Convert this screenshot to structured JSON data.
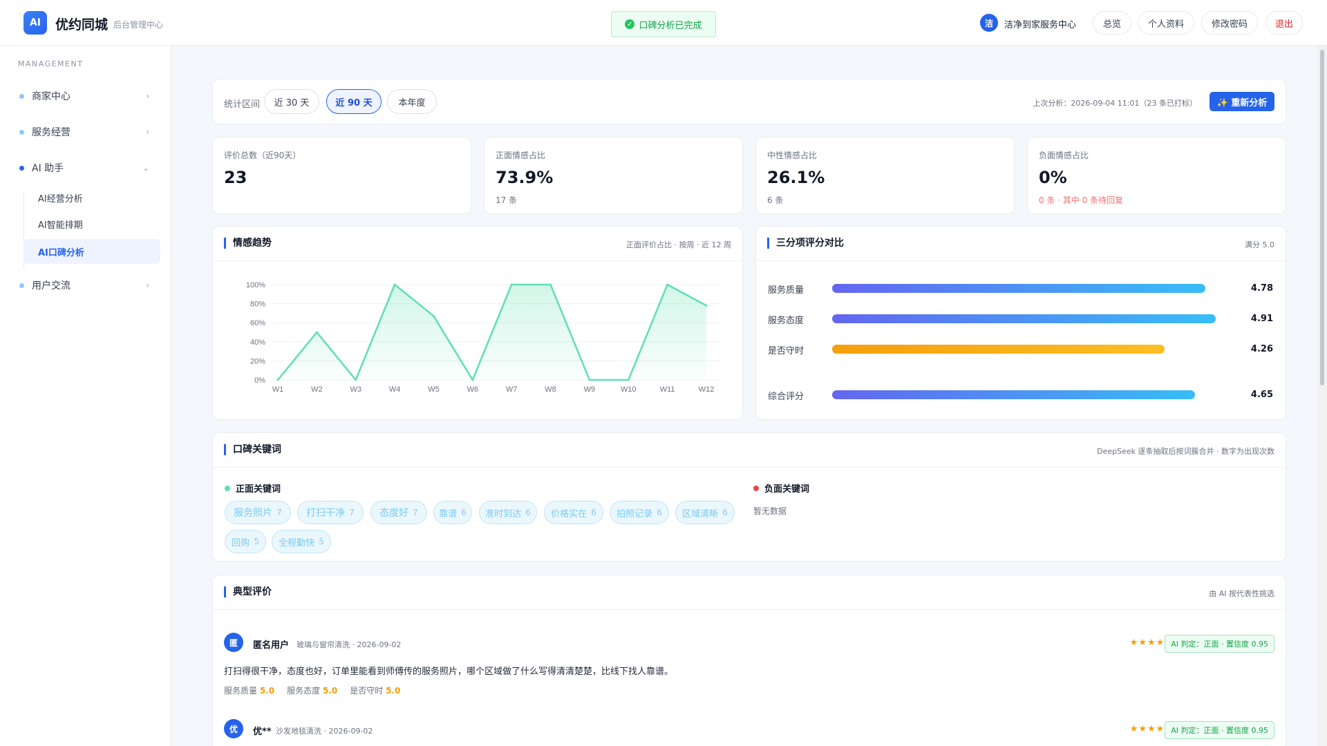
{
  "header": {
    "logo": "AI",
    "brand": "优约同城",
    "subtitle": "后台管理中心",
    "toast": "口碑分析已完成",
    "merchant_avatar": "洁",
    "merchant_name": "洁净到家服务中心",
    "buttons": {
      "overview": "总览",
      "profile": "个人资料",
      "password": "修改密码",
      "logout": "退出"
    }
  },
  "sidebar": {
    "section": "MANAGEMENT",
    "items": [
      {
        "label": "商家中心",
        "chevron": "›"
      },
      {
        "label": "服务经营",
        "chevron": "›"
      },
      {
        "label": "AI 助手",
        "chevron": "⌄"
      },
      {
        "label": "用户交流",
        "chevron": "›"
      }
    ],
    "sub_items": [
      {
        "label": "AI经营分析"
      },
      {
        "label": "AI智能排期"
      },
      {
        "label": "AI口碑分析"
      }
    ]
  },
  "filter": {
    "label": "统计区间",
    "options": [
      "近 30 天",
      "近 90 天",
      "本年度"
    ],
    "selected": "近 90 天",
    "last_analysis": "上次分析：2026-09-04 11:01（23 条已打标）",
    "reanalyze": "✨ 重新分析"
  },
  "stats": [
    {
      "label": "评价总数（近90天）",
      "value": "23",
      "sub": ""
    },
    {
      "label": "正面情感占比",
      "value": "73.9%",
      "sub": "17 条"
    },
    {
      "label": "中性情感占比",
      "value": "26.1%",
      "sub": "6 条"
    },
    {
      "label": "负面情感占比",
      "value": "0%",
      "sub": "0 条 · 其中 0 条待回复"
    }
  ],
  "trend": {
    "title": "情感趋势",
    "note": "正面评价占比 · 按周 · 近 12 周"
  },
  "chart_data": {
    "type": "area",
    "x": [
      "W1",
      "W2",
      "W3",
      "W4",
      "W5",
      "W6",
      "W7",
      "W8",
      "W9",
      "W10",
      "W11",
      "W12"
    ],
    "series": [
      {
        "values": [
          0,
          50,
          0,
          100,
          67,
          0,
          100,
          100,
          0,
          0,
          100,
          78
        ]
      }
    ],
    "ylim": [
      0,
      100
    ],
    "yticks": [
      "0%",
      "20%",
      "40%",
      "60%",
      "80%",
      "100%"
    ],
    "color": "#5ee0b0",
    "grid": true
  },
  "ratings": {
    "title": "三分项评分对比",
    "note": "满分 5.0",
    "max": 5.0,
    "items": [
      {
        "label": "服务质量",
        "value": "4.78",
        "score": 4.78,
        "gradient": [
          "#6366f1",
          "#38bdf8"
        ]
      },
      {
        "label": "服务态度",
        "value": "4.91",
        "score": 4.91,
        "gradient": [
          "#6366f1",
          "#38bdf8"
        ]
      },
      {
        "label": "是否守时",
        "value": "4.26",
        "score": 4.26,
        "gradient": [
          "#f59e0b",
          "#fbbf24"
        ]
      },
      {
        "label": "综合评分",
        "value": "4.65",
        "score": 4.65,
        "gradient": [
          "#6366f1",
          "#38bdf8"
        ]
      }
    ]
  },
  "keywords": {
    "title": "口碑关键词",
    "note": "DeepSeek 逐条抽取后按词簇合并 · 数字为出现次数",
    "positive_title": "正面关键词",
    "negative_title": "负面关键词",
    "negative_empty": "暂无数据",
    "positive": [
      {
        "word": "服务照片",
        "count": "7"
      },
      {
        "word": "打扫干净",
        "count": "7"
      },
      {
        "word": "态度好",
        "count": "7"
      },
      {
        "word": "靠谱",
        "count": "6"
      },
      {
        "word": "准时到达",
        "count": "6"
      },
      {
        "word": "价格实在",
        "count": "6"
      },
      {
        "word": "拍照记录",
        "count": "6"
      },
      {
        "word": "区域清晰",
        "count": "6"
      },
      {
        "word": "回购",
        "count": "5"
      },
      {
        "word": "全程勤快",
        "count": "5"
      }
    ]
  },
  "reviews": {
    "title": "典型评价",
    "note": "由 AI 按代表性挑选",
    "items": [
      {
        "avatar": "匿",
        "name": "匿名用户",
        "meta": "玻璃与窗帘清洗 · 2026-09-02",
        "stars": "★★★★★",
        "badge": "AI 判定：正面 · 置信度 0.95",
        "text": "打扫得很干净，态度也好，订单里能看到师傅传的服务照片，哪个区域做了什么写得清清楚楚，比线下找人靠谱。",
        "scores": [
          {
            "label": "服务质量",
            "value": "5.0"
          },
          {
            "label": "服务态度",
            "value": "5.0"
          },
          {
            "label": "是否守时",
            "value": "5.0"
          }
        ]
      },
      {
        "avatar": "优",
        "name": "优**",
        "meta": "沙发地毯清洗 · 2026-09-02",
        "stars": "★★★★★",
        "badge": "AI 判定：正面 · 置信度 0.95"
      }
    ]
  }
}
